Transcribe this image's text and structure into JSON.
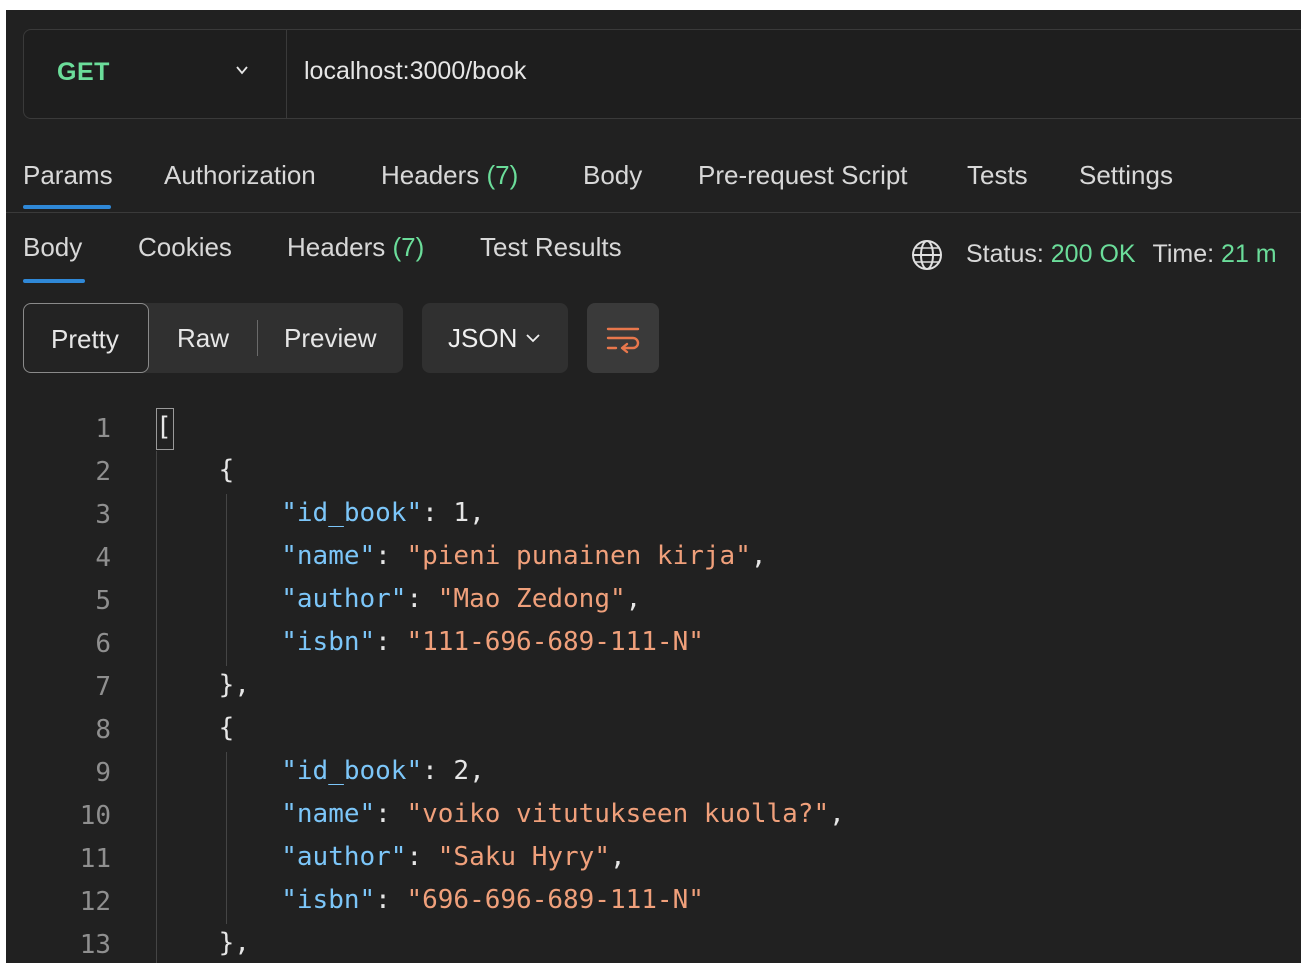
{
  "request": {
    "method": "GET",
    "url": "localhost:3000/book"
  },
  "request_tabs": [
    {
      "label": "Params",
      "count": "",
      "active": true
    },
    {
      "label": "Authorization",
      "count": "",
      "active": false
    },
    {
      "label": "Headers",
      "count": "(7)",
      "active": false
    },
    {
      "label": "Body",
      "count": "",
      "active": false
    },
    {
      "label": "Pre-request Script",
      "count": "",
      "active": false
    },
    {
      "label": "Tests",
      "count": "",
      "active": false
    },
    {
      "label": "Settings",
      "count": "",
      "active": false
    }
  ],
  "response_tabs": [
    {
      "label": "Body",
      "count": "",
      "active": true
    },
    {
      "label": "Cookies",
      "count": "",
      "active": false
    },
    {
      "label": "Headers",
      "count": "(7)",
      "active": false
    },
    {
      "label": "Test Results",
      "count": "",
      "active": false
    }
  ],
  "status": {
    "status_label": "Status:",
    "status_value": "200 OK",
    "time_label": "Time:",
    "time_value": "21 m",
    "icon": "globe-icon"
  },
  "view_modes": [
    "Pretty",
    "Raw",
    "Preview"
  ],
  "active_view_mode": "Pretty",
  "format": "JSON",
  "wrap_icon": "wrap-lines-icon",
  "colors": {
    "background": "#212121",
    "green": "#6bdd9a",
    "json_key": "#7cc6f9",
    "json_string": "#f0a07b",
    "active_tab": "#2f88d7"
  },
  "code_lines": [
    {
      "n": "1",
      "text": "["
    },
    {
      "n": "2",
      "text": "    {"
    },
    {
      "n": "3",
      "text": "        \"id_book\": 1,"
    },
    {
      "n": "4",
      "text": "        \"name\": \"pieni punainen kirja\","
    },
    {
      "n": "5",
      "text": "        \"author\": \"Mao Zedong\","
    },
    {
      "n": "6",
      "text": "        \"isbn\": \"111-696-689-111-N\""
    },
    {
      "n": "7",
      "text": "    },"
    },
    {
      "n": "8",
      "text": "    {"
    },
    {
      "n": "9",
      "text": "        \"id_book\": 2,"
    },
    {
      "n": "10",
      "text": "        \"name\": \"voiko vitutukseen kuolla?\","
    },
    {
      "n": "11",
      "text": "        \"author\": \"Saku Hyry\","
    },
    {
      "n": "12",
      "text": "        \"isbn\": \"696-696-689-111-N\""
    },
    {
      "n": "13",
      "text": "    },"
    }
  ]
}
